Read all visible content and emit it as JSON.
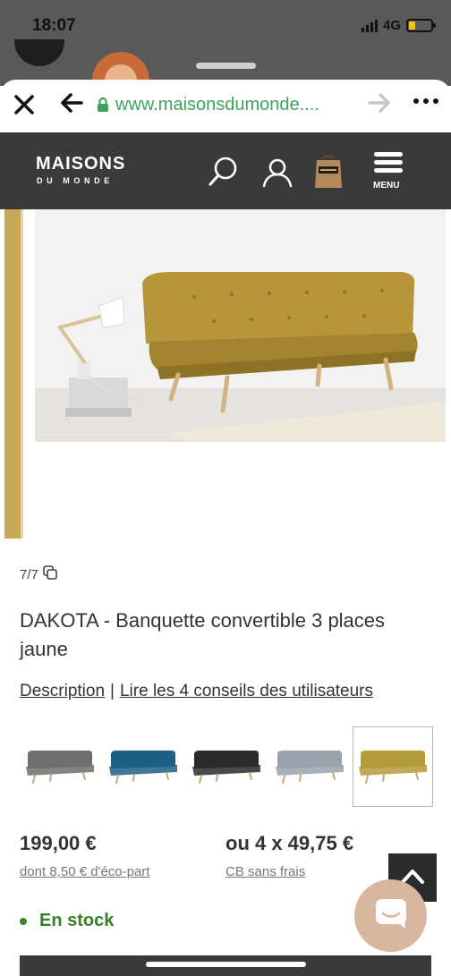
{
  "status": {
    "time": "18:07",
    "network": "4G"
  },
  "browser": {
    "url": "www.maisonsdumonde....",
    "icons": {
      "close": "close-icon",
      "back": "arrow-left-icon",
      "lock": "lock-icon",
      "forward": "arrow-right-icon",
      "more": "more-icon"
    },
    "url_color": "#3ba55c"
  },
  "header": {
    "logo_main": "MAISONS",
    "logo_sub": "DU MONDE",
    "menu_label": "MENU",
    "icons": [
      "search-icon",
      "user-icon",
      "shopping-bag-icon",
      "menu-icon"
    ],
    "bg_color": "#3a3a38"
  },
  "product": {
    "image_counter": "7/7",
    "title": "DAKOTA - Banquette convertible 3 places jaune",
    "links": {
      "description": "Description",
      "separator": "|",
      "reviews": "Lire les 4 conseils des utilisateurs"
    },
    "swatches": [
      {
        "color": "#6e6e6e",
        "name": "grey"
      },
      {
        "color": "#1f5f86",
        "name": "blue"
      },
      {
        "color": "#2a2a2a",
        "name": "black"
      },
      {
        "color": "#9aa3ab",
        "name": "light-grey"
      },
      {
        "color": "#b59a3a",
        "name": "yellow",
        "selected": true
      }
    ],
    "price": "199,00 €",
    "eco_part": "dont 8,50 € d'éco-part",
    "installment": "ou 4 x 49,75 €",
    "installment_note": "CB sans frais",
    "stock": "En stock",
    "stock_color": "#3a7d2c"
  }
}
